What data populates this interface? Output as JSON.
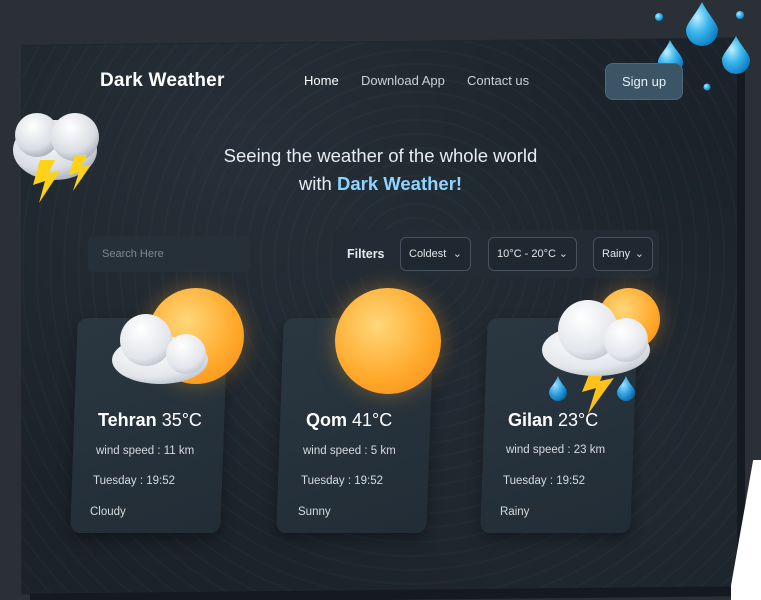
{
  "brand": "Dark Weather",
  "nav": {
    "home": "Home",
    "download": "Download App",
    "contact": "Contact us"
  },
  "signup": "Sign up",
  "headline": {
    "line1": "Seeing the weather of the whole world",
    "line2_prefix": "with ",
    "line2_brand": "Dark Weather!"
  },
  "search": {
    "placeholder": "Search Here"
  },
  "filters": {
    "label": "Filters",
    "temp_order": "Coldest",
    "range": "10°C - 20°C",
    "condition": "Rainy"
  },
  "cards": [
    {
      "city": "Tehran",
      "temp": "35°C",
      "wind": "wind speed : 11 km",
      "day": "Tuesday : 19:52",
      "condition": "Cloudy",
      "icon": "sun-cloud-icon"
    },
    {
      "city": "Qom",
      "temp": "41°C",
      "wind": "wind speed : 5 km",
      "day": "Tuesday : 19:52",
      "condition": "Sunny",
      "icon": "sun-icon"
    },
    {
      "city": "Gilan",
      "temp": "23°C",
      "wind": "wind speed : 23 km",
      "day": "Tuesday : 19:52",
      "condition": "Rainy",
      "icon": "storm-icon"
    }
  ],
  "colors": {
    "accent": "#8fd4ff",
    "panel": "#1b2229",
    "button": "#3b5566"
  }
}
